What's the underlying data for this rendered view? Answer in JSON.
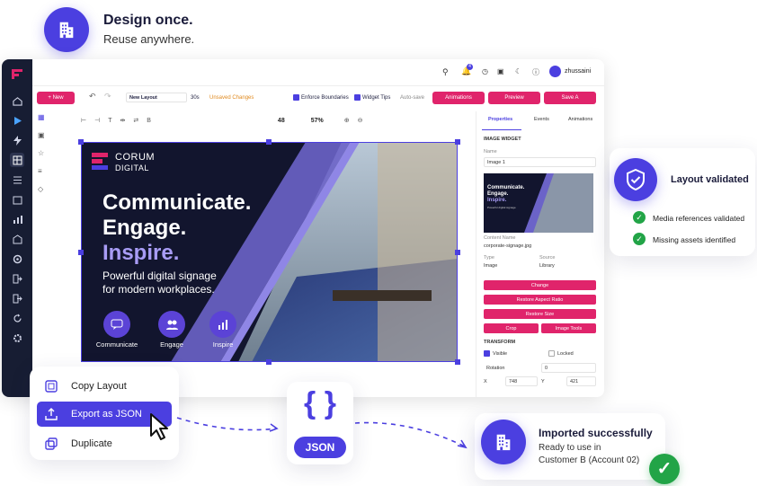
{
  "hero": {
    "title": "Design once.",
    "subtitle": "Reuse anywhere."
  },
  "app": {
    "user": "zhussaini",
    "notif_count": "4",
    "toolbar": {
      "new": "+ New",
      "layout_name": "New Layout",
      "duration": "30s",
      "unsaved": "Unsaved Changes",
      "enforce": "Enforce Boundaries",
      "widget_tips": "Widget Tips",
      "autosave": "Auto-save",
      "animations": "Animations",
      "preview": "Preview",
      "save": "Save A"
    },
    "canvas_toolbar": {
      "font_size": "48",
      "zoom": "57%"
    },
    "panel": {
      "tabs": [
        "Properties",
        "Events",
        "Animations"
      ],
      "section": "IMAGE WIDGET",
      "name_label": "Name",
      "name_value": "Image 1",
      "content_name_label": "Content Name",
      "content_name": "corporate-signage.jpg",
      "type_label": "Type",
      "type_value": "Image",
      "source_label": "Source",
      "source_value": "Library",
      "buttons": [
        "Change",
        "Restore Aspect Ratio",
        "Restore Size"
      ],
      "crop": "Crop",
      "image_tools": "Image Tools",
      "transform": "TRANSFORM",
      "visible": "Visible",
      "locked": "Locked",
      "rotation_label": "Rotation",
      "rotation": "0",
      "x_label": "X",
      "x": "748",
      "y_label": "Y",
      "y": "421"
    },
    "slide": {
      "brand1": "CORUM",
      "brand2": "DIGITAL",
      "line1": "Communicate.",
      "line2": "Engage.",
      "line3": "Inspire.",
      "tag1": "Powerful digital signage",
      "tag2": "for modern workplaces.",
      "features": [
        "Communicate",
        "Engage",
        "Inspire"
      ],
      "thumb": {
        "l1": "Communicate.",
        "l2": "Engage.",
        "l3": "Inspire.",
        "tag": "Powerful digital signage"
      }
    }
  },
  "validation": {
    "title": "Layout validated",
    "items": [
      "Media references validated",
      "Missing assets identified"
    ]
  },
  "context_menu": {
    "items": [
      "Copy Layout",
      "Export as JSON",
      "Duplicate"
    ]
  },
  "json_badge": {
    "label": "JSON",
    "glyph": "{ }"
  },
  "import": {
    "title": "Imported successfully",
    "line1": "Ready to use in",
    "line2": "Customer B (Account 02)"
  },
  "colors": {
    "accent": "#4b3fe0",
    "pink": "#e0246b",
    "navy": "#171d33",
    "success": "#22a447"
  }
}
